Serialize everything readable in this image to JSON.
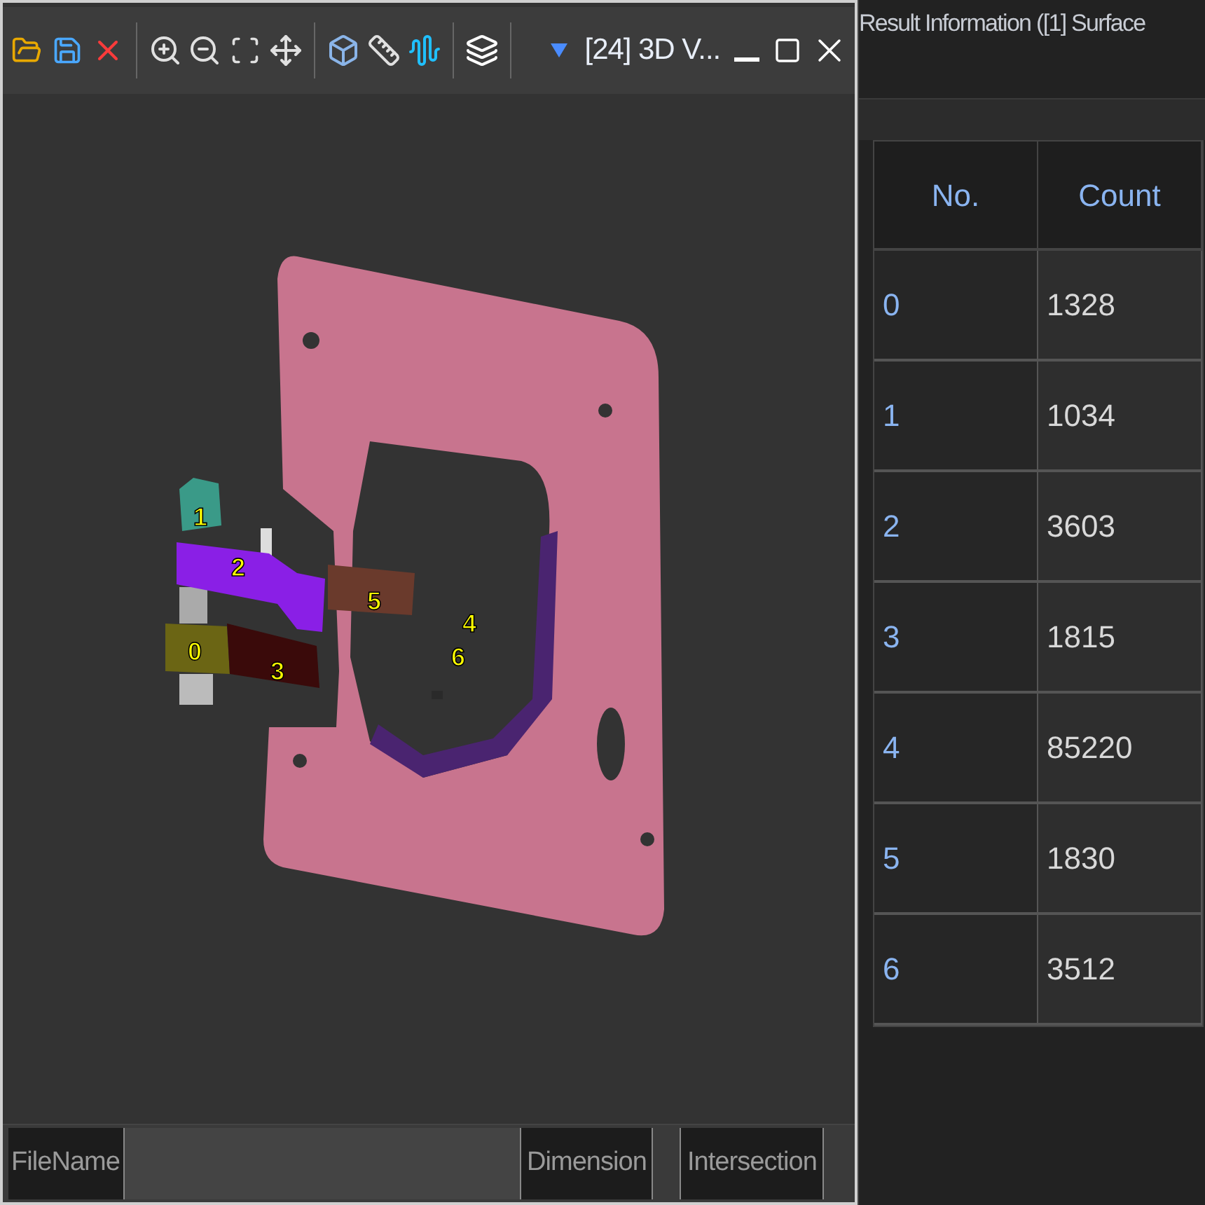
{
  "viewer": {
    "title": "[24] 3D V...",
    "segments": [
      {
        "label": "0",
        "color": "#6b6514"
      },
      {
        "label": "1",
        "color": "#3a9a88"
      },
      {
        "label": "2",
        "color": "#8a1fe6"
      },
      {
        "label": "3",
        "color": "#3a0a0a"
      },
      {
        "label": "4",
        "color": "#4a2470"
      },
      {
        "label": "5",
        "color": "#6a3a2c"
      },
      {
        "label": "6",
        "color": "#2a2a2a"
      }
    ],
    "status_bar": {
      "filename_label": "FileName",
      "dimension_label": "Dimension",
      "intersection_label": "Intersection"
    }
  },
  "result_panel": {
    "title": "Result Information ([1] Surface",
    "table": {
      "columns": [
        "No.",
        "Count"
      ],
      "rows": [
        [
          "0",
          "1328"
        ],
        [
          "1",
          "1034"
        ],
        [
          "2",
          "3603"
        ],
        [
          "3",
          "1815"
        ],
        [
          "4",
          "85220"
        ],
        [
          "5",
          "1830"
        ],
        [
          "6",
          "3512"
        ]
      ]
    }
  }
}
